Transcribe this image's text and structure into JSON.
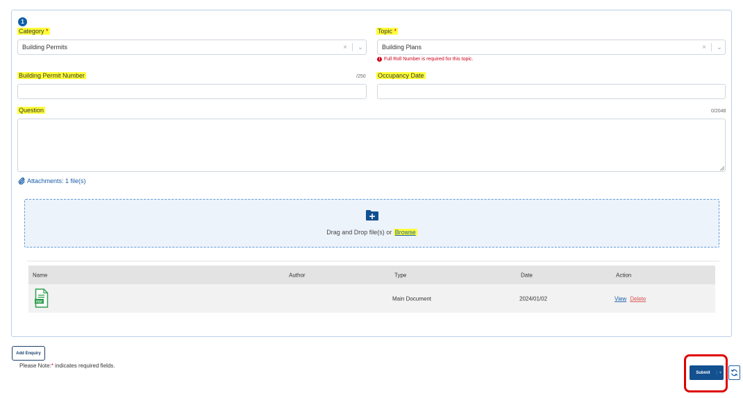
{
  "step_number": "1",
  "form": {
    "category": {
      "label": "Category",
      "required_mark": "*",
      "value": "Building Permits"
    },
    "topic": {
      "label": "Topic",
      "required_mark": "*",
      "value": "Building Plans",
      "error": "Full Roll Number is required for this topic."
    },
    "permit_number": {
      "label": "Building Permit Number",
      "counter": "/250",
      "value": ""
    },
    "occupancy_date": {
      "label": "Occupancy Date",
      "value": ""
    },
    "question": {
      "label": "Question",
      "counter": "0/2048",
      "value": ""
    },
    "select_clear_glyph": "×",
    "select_chevron_glyph": "⌄"
  },
  "attachments": {
    "label": "Attachments: 1 file(s)",
    "icon": "paperclip-icon",
    "dropzone": {
      "text": "Drag and Drop file(s) or",
      "browse_label": "Browse",
      "icon": "folder-plus-icon"
    },
    "table": {
      "headers": {
        "name": "Name",
        "author": "Author",
        "type": "Type",
        "date": "Date",
        "action": "Action"
      },
      "rows": [
        {
          "icon": "pdf-file-icon",
          "name": "",
          "author": "",
          "type": "Main Document",
          "date": "2024/01/02",
          "view_label": "View",
          "delete_label": "Delete"
        }
      ]
    }
  },
  "actions": {
    "add_enquiry_label": "Add Enquiry",
    "note_prefix": "Please Note:",
    "note_mark": "*",
    "note_suffix": " indicates required fields.",
    "submit_label": "Submit",
    "submit_caret": "▾",
    "refresh_icon": "refresh-icon"
  },
  "colors": {
    "primary": "#12508f",
    "highlight": "#ffff38",
    "error": "#d0021b",
    "callout": "#e00000",
    "pdf_green": "#2e9e4f"
  }
}
